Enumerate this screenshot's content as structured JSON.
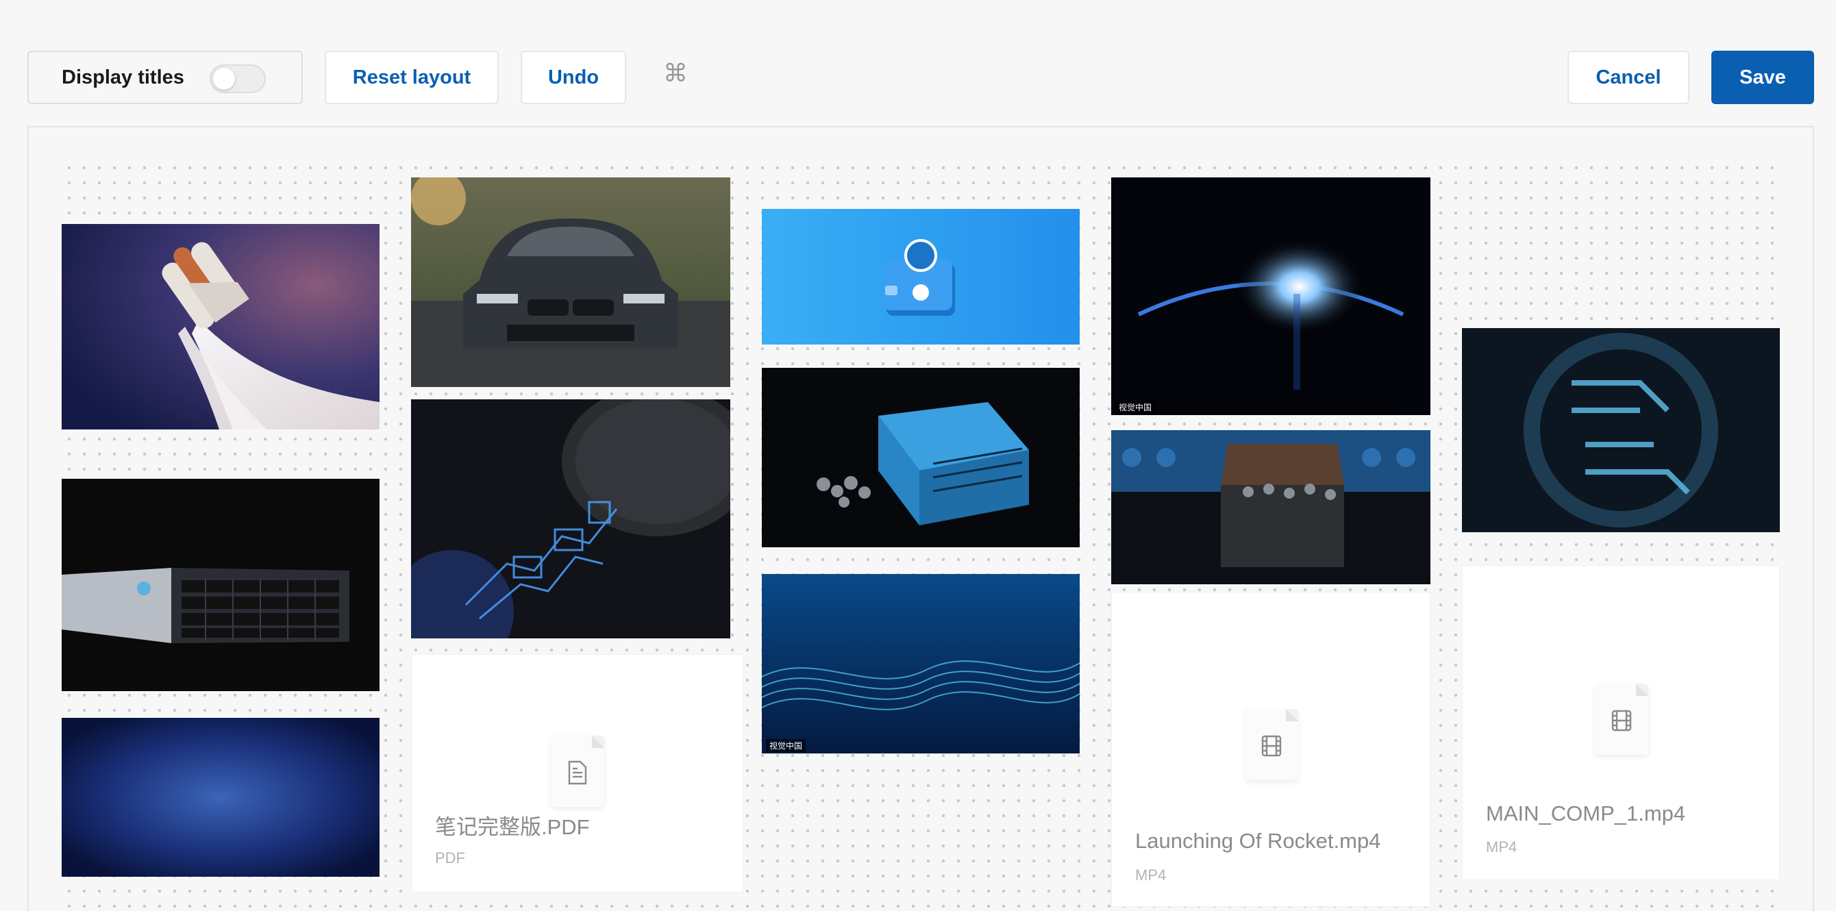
{
  "toolbar": {
    "display_titles_label": "Display titles",
    "display_titles_on": false,
    "reset_label": "Reset layout",
    "undo_label": "Undo",
    "shortcut_glyph": "⌘",
    "cancel_label": "Cancel",
    "save_label": "Save"
  },
  "watermark": "视觉中国",
  "files": [
    {
      "name": "笔记完整版.PDF",
      "type": "PDF",
      "icon": "document-icon"
    },
    {
      "name": "Launching Of Rocket.mp4",
      "type": "MP4",
      "icon": "film-icon"
    },
    {
      "name": "MAIN_COMP_1.mp4",
      "type": "MP4",
      "icon": "film-icon"
    }
  ],
  "colors": {
    "accent": "#0a5fb0",
    "background": "#f7f7f7",
    "wallet_blue": "#2f9cf0"
  }
}
